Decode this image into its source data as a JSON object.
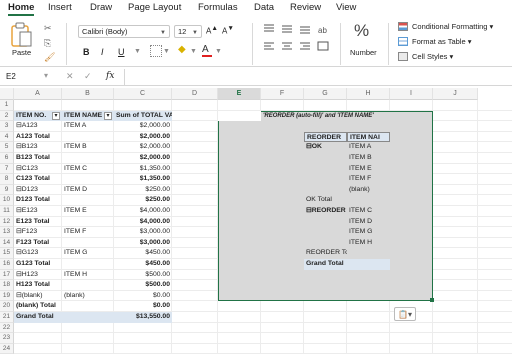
{
  "ribbon_tabs": [
    "Home",
    "Insert",
    "Draw",
    "Page Layout",
    "Formulas",
    "Data",
    "Review",
    "View"
  ],
  "ribbon": {
    "paste_label": "Paste",
    "font_name": "Calibri (Body)",
    "font_size": "12",
    "number_label": "Number",
    "percent_symbol": "%",
    "conditional_formatting": "Conditional Formatting",
    "format_as_table": "Format as Table",
    "cell_styles": "Cell Styles",
    "bold": "B",
    "italic": "I",
    "underline": "U",
    "font_color": "A"
  },
  "formula_bar": {
    "name_box": "E2",
    "fx": "fx",
    "value": ""
  },
  "columns": [
    "A",
    "B",
    "C",
    "D",
    "E",
    "F",
    "G",
    "H",
    "I",
    "J"
  ],
  "rows": [
    "1",
    "2",
    "3",
    "4",
    "5",
    "6",
    "7",
    "8",
    "9",
    "10",
    "11",
    "12",
    "13",
    "14",
    "15",
    "16",
    "17",
    "18",
    "19",
    "20",
    "21",
    "22",
    "23",
    "24"
  ],
  "pivot1": {
    "headers": [
      "ITEM NO.",
      "ITEM NAME",
      "Sum of TOTAL VALUE"
    ],
    "rows": [
      {
        "a": "⊟A123",
        "b": "ITEM A",
        "c": "$2,000.00",
        "bold": false
      },
      {
        "a": "A123 Total",
        "b": "",
        "c": "$2,000.00",
        "bold": true
      },
      {
        "a": "⊟B123",
        "b": "ITEM B",
        "c": "$2,000.00",
        "bold": false
      },
      {
        "a": "B123 Total",
        "b": "",
        "c": "$2,000.00",
        "bold": true
      },
      {
        "a": "⊟C123",
        "b": "ITEM C",
        "c": "$1,350.00",
        "bold": false
      },
      {
        "a": "C123 Total",
        "b": "",
        "c": "$1,350.00",
        "bold": true
      },
      {
        "a": "⊟D123",
        "b": "ITEM D",
        "c": "$250.00",
        "bold": false
      },
      {
        "a": "D123 Total",
        "b": "",
        "c": "$250.00",
        "bold": true
      },
      {
        "a": "⊟E123",
        "b": "ITEM E",
        "c": "$4,000.00",
        "bold": false
      },
      {
        "a": "E123 Total",
        "b": "",
        "c": "$4,000.00",
        "bold": true
      },
      {
        "a": "⊟F123",
        "b": "ITEM F",
        "c": "$3,000.00",
        "bold": false
      },
      {
        "a": "F123 Total",
        "b": "",
        "c": "$3,000.00",
        "bold": true
      },
      {
        "a": "⊟G123",
        "b": "ITEM G",
        "c": "$450.00",
        "bold": false
      },
      {
        "a": "G123 Total",
        "b": "",
        "c": "$450.00",
        "bold": true
      },
      {
        "a": "⊟H123",
        "b": "ITEM H",
        "c": "$500.00",
        "bold": false
      },
      {
        "a": "H123 Total",
        "b": "",
        "c": "$500.00",
        "bold": true
      },
      {
        "a": "⊟(blank)",
        "b": "(blank)",
        "c": "$0.00",
        "bold": false
      },
      {
        "a": "(blank) Total",
        "b": "",
        "c": "$0.00",
        "bold": true
      },
      {
        "a": "Grand Total",
        "b": "",
        "c": "$13,550.00",
        "bold": true
      }
    ]
  },
  "pivot2": {
    "title": "'REORDER (auto-fill)' and 'ITEM NAME'",
    "header_g": "REORDER",
    "header_h": "ITEM NAI",
    "rows": [
      {
        "g": "⊟OK",
        "h": "ITEM A",
        "indent": false,
        "bold": true
      },
      {
        "g": "",
        "h": "ITEM B",
        "indent": false,
        "bold": false
      },
      {
        "g": "",
        "h": "ITEM E",
        "indent": false,
        "bold": false
      },
      {
        "g": "",
        "h": "ITEM F",
        "indent": false,
        "bold": false
      },
      {
        "g": "",
        "h": "(blank)",
        "indent": false,
        "bold": false
      },
      {
        "g": "OK Total",
        "h": "",
        "indent": false,
        "bold": false
      },
      {
        "g": "⊟REORDER",
        "h": "ITEM C",
        "indent": false,
        "bold": true
      },
      {
        "g": "",
        "h": "ITEM D",
        "indent": false,
        "bold": false
      },
      {
        "g": "",
        "h": "ITEM G",
        "indent": false,
        "bold": false
      },
      {
        "g": "",
        "h": "ITEM H",
        "indent": false,
        "bold": false
      },
      {
        "g": "REORDER Total",
        "h": "",
        "indent": false,
        "bold": false
      },
      {
        "g": "Grand Total",
        "h": "",
        "indent": false,
        "bold": true
      }
    ]
  },
  "colors": {
    "accent": "#217346",
    "pivot_header": "#dce6f1",
    "selection_border": "#217346",
    "selection_fill": "#d9d9d9"
  }
}
